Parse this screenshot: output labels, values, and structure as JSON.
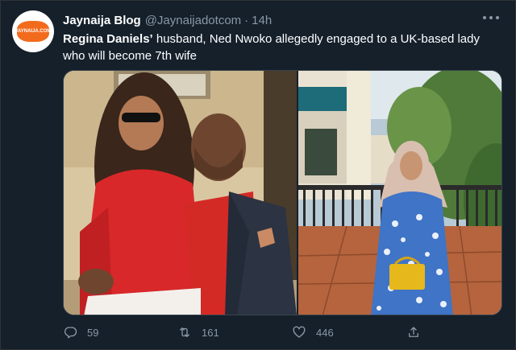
{
  "tweet": {
    "author_name": "Jaynaija Blog",
    "handle": "@Jaynaijadotcom",
    "separator": "·",
    "time": "14h",
    "avatar_text": "JAYNAIJA.COM",
    "text_bold": "Regina Daniels’",
    "text_rest": " husband, Ned Nwoko allegedly engaged to a UK-based lady who will become 7th wife"
  },
  "media": {
    "left_photo": "couple-photo",
    "right_photo": "woman-in-hijab-photo"
  },
  "actions": {
    "replies": "59",
    "retweets": "161",
    "likes": "446"
  },
  "colors": {
    "background": "#15202b",
    "text": "#ffffff",
    "muted": "#8b98a5",
    "brand_orange": "#f26b1d"
  }
}
